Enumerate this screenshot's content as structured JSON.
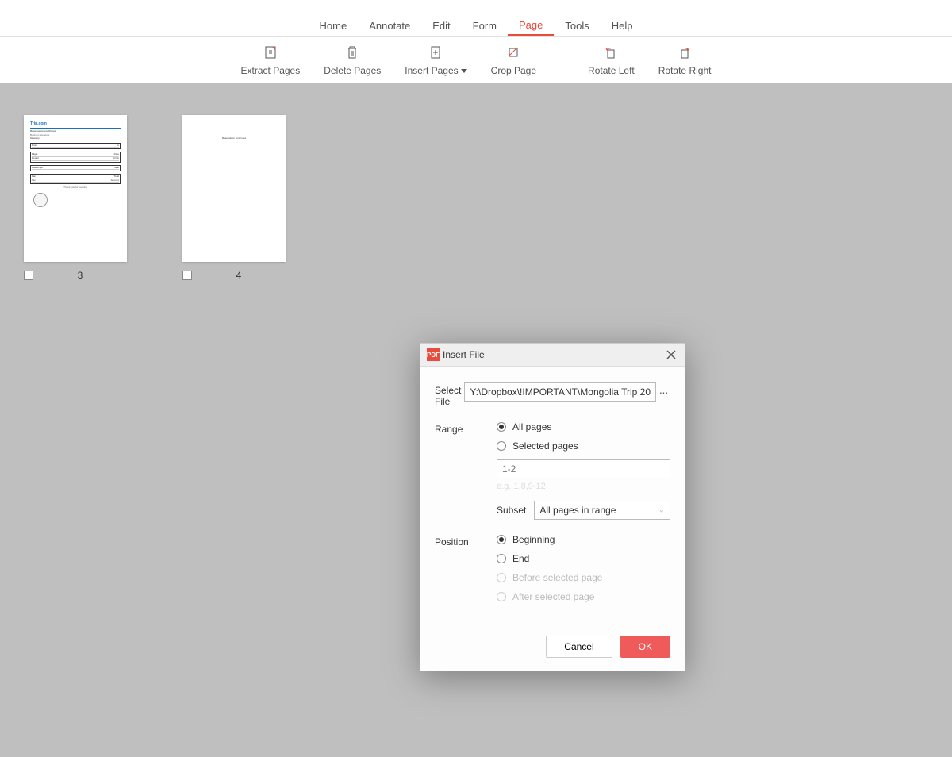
{
  "menu": {
    "home": "Home",
    "annotate": "Annotate",
    "edit": "Edit",
    "form": "Form",
    "page": "Page",
    "tools": "Tools",
    "help": "Help"
  },
  "toolbar": {
    "extract": "Extract Pages",
    "delete": "Delete Pages",
    "insert": "Insert Pages",
    "crop": "Crop Page",
    "rotate_left": "Rotate Left",
    "rotate_right": "Rotate Right"
  },
  "pages": {
    "p1_num": "3",
    "p2_num": "4",
    "thumb1_header": "Trip.com",
    "thumb2_text": "Reservation confirmed"
  },
  "dialog": {
    "title": "Insert File",
    "icon_text": "PDF",
    "select_file_label": "Select File",
    "file_value": "Y:\\Dropbox\\!IMPORTANT\\Mongolia Trip 20",
    "browse_dots": "···",
    "range_label": "Range",
    "range_all": "All pages",
    "range_selected": "Selected pages",
    "range_input_placeholder": "1-2",
    "range_hint": "e.g. 1,8,9-12",
    "subset_label": "Subset",
    "subset_value": "All pages in range",
    "position_label": "Position",
    "pos_beginning": "Beginning",
    "pos_end": "End",
    "pos_before": "Before selected page",
    "pos_after": "After selected page",
    "cancel": "Cancel",
    "ok": "OK"
  }
}
